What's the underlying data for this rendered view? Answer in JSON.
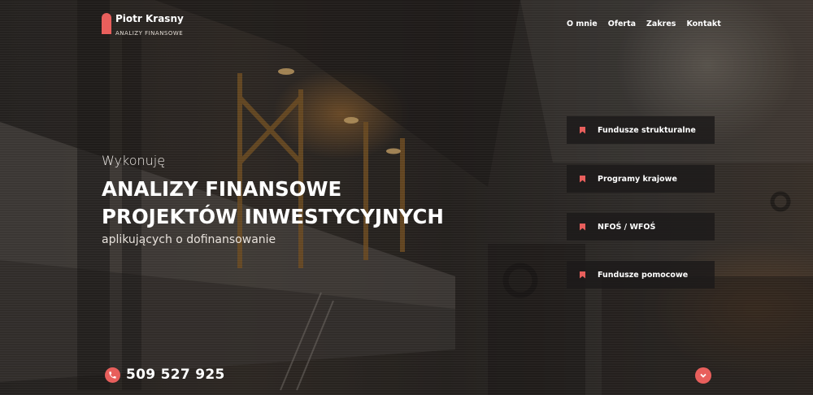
{
  "brand": {
    "name": "Piotr Krasny",
    "tagline": "ANALIZY FINANSOWE",
    "accent_color": "#e85f5c"
  },
  "nav": {
    "items": [
      {
        "label": "O mnie"
      },
      {
        "label": "Oferta"
      },
      {
        "label": "Zakres"
      },
      {
        "label": "Kontakt"
      }
    ]
  },
  "hero": {
    "kicker": "Wykonuję",
    "headline_line1": "ANALIZY FINANSOWE",
    "headline_line2": "PROJEKTÓW INWESTYCYJNYCH",
    "subtitle": "aplikujących o dofinansowanie"
  },
  "services": [
    {
      "label": "Fundusze strukturalne",
      "icon": "bookmark-icon"
    },
    {
      "label": "Programy krajowe",
      "icon": "bookmark-icon"
    },
    {
      "label": "NFOŚ / WFOŚ",
      "icon": "bookmark-icon"
    },
    {
      "label": "Fundusze pomocowe",
      "icon": "bookmark-icon"
    }
  ],
  "contact": {
    "phone": "509 527 925",
    "phone_icon": "phone-icon"
  },
  "scroll_icon": "chevron-down-icon"
}
